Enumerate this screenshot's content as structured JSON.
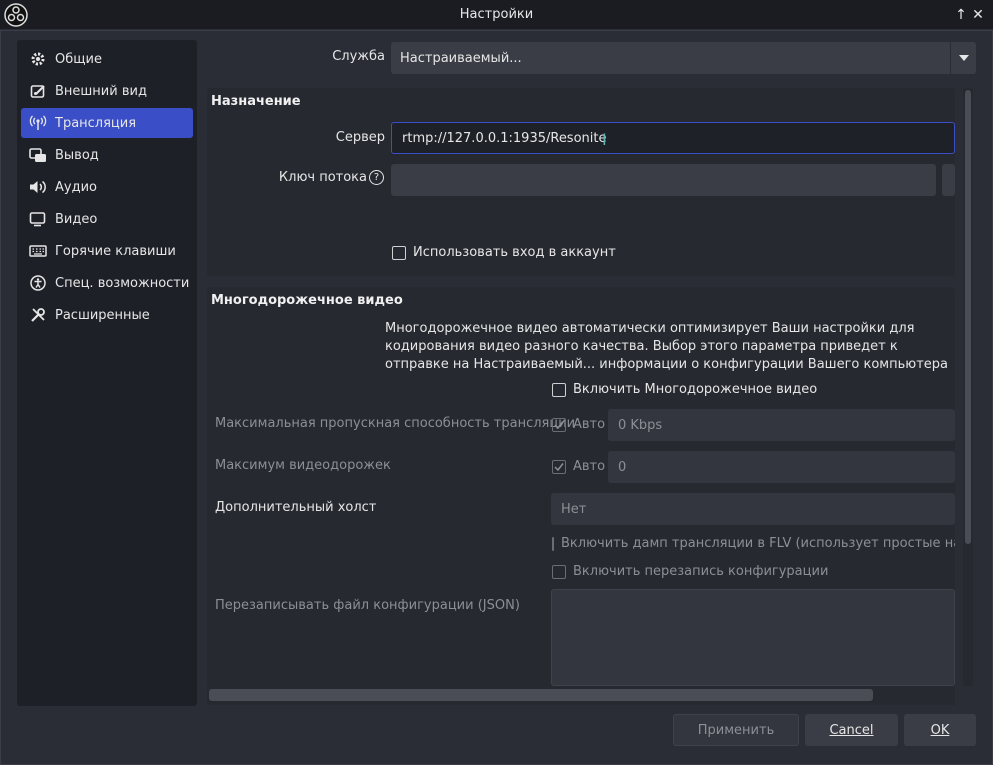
{
  "window": {
    "title": "Настройки"
  },
  "sidebar": {
    "items": [
      {
        "label": "Общие",
        "icon": "gear-icon"
      },
      {
        "label": "Внешний вид",
        "icon": "appearance-icon"
      },
      {
        "label": "Трансляция",
        "icon": "broadcast-icon"
      },
      {
        "label": "Вывод",
        "icon": "output-icon"
      },
      {
        "label": "Аудио",
        "icon": "speaker-icon"
      },
      {
        "label": "Видео",
        "icon": "monitor-icon"
      },
      {
        "label": "Горячие клавиши",
        "icon": "keyboard-icon"
      },
      {
        "label": "Спец. возможности",
        "icon": "accessibility-icon"
      },
      {
        "label": "Расширенные",
        "icon": "tools-icon"
      }
    ],
    "active_index": 2
  },
  "service": {
    "label": "Служба",
    "value": "Настраиваемый..."
  },
  "destination": {
    "title": "Назначение",
    "server_label": "Сервер",
    "server_value": "rtmp://127.0.0.1:1935/Resonite",
    "key_label": "Ключ потока",
    "key_value": "",
    "account_checkbox": "Использовать вход в аккаунт",
    "account_checked": false
  },
  "multitrack": {
    "title": "Многодорожечное видео",
    "description": "Многодорожечное видео автоматически оптимизирует Ваши настройки для кодирования видео разного качества. Выбор этого параметра приведет к отправке на Настраиваемый... информации о конфигурации Вашего компьютера и настройках программы.",
    "enable_checkbox": "Включить Многодорожечное видео",
    "enable_checked": false,
    "max_bandwidth_label": "Максимальная пропускная способность трансляции",
    "max_bandwidth_auto": "Авто",
    "max_bandwidth_value": "0 Kbps",
    "max_tracks_label": "Максимум видеодорожек",
    "max_tracks_auto": "Авто",
    "max_tracks_value": "0",
    "extra_canvas_label": "Дополнительный холст",
    "extra_canvas_value": "Нет",
    "flv_dump_checkbox": "Включить дамп трансляции в FLV (использует простые настро",
    "config_override_checkbox": "Включить перезапись конфигурации",
    "config_file_label": "Перезаписывать файл конфигурации (JSON)"
  },
  "buttons": {
    "apply": "Применить",
    "cancel": "Cancel",
    "ok": "OK"
  },
  "colors": {
    "accent": "#3a4fc7",
    "background": "#2a2d35"
  }
}
